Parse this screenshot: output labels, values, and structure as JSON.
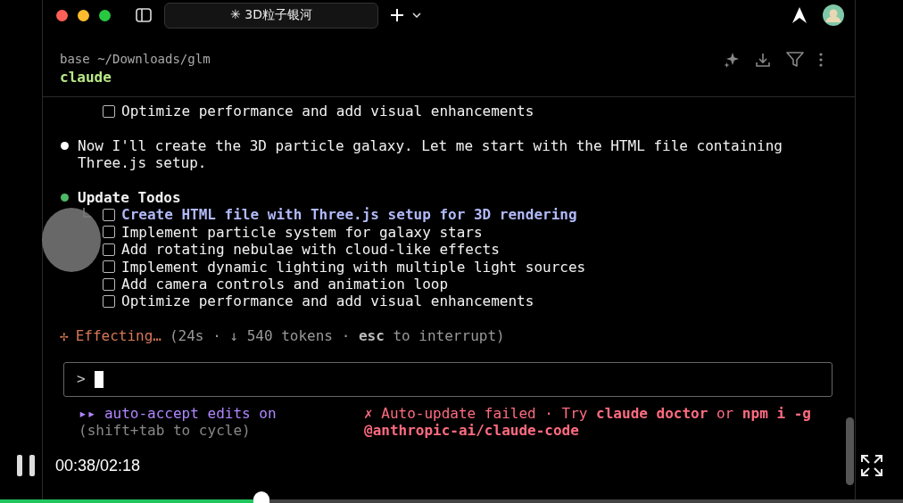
{
  "title_bar": {
    "tab_title": "✳ 3D粒子银河"
  },
  "header": {
    "path": "base ~/Downloads/glm",
    "command": "claude"
  },
  "transcript": [
    {
      "kind": "todo_list",
      "items": [
        {
          "text": "Optimize performance and add visual enhancements",
          "checked": false,
          "active": false
        }
      ]
    },
    {
      "kind": "message",
      "color": "#ffffff",
      "text": "Now I'll create the 3D particle galaxy. Let me start with the HTML file containing Three.js setup."
    },
    {
      "kind": "tool",
      "color": "#4eba65",
      "title": "Update Todos",
      "items": [
        {
          "text": "Create HTML file with Three.js setup for 3D rendering",
          "checked": false,
          "active": true
        },
        {
          "text": "Implement particle system for galaxy stars",
          "checked": false,
          "active": false
        },
        {
          "text": "Add rotating nebulae with cloud-like effects",
          "checked": false,
          "active": false
        },
        {
          "text": "Implement dynamic lighting with multiple light sources",
          "checked": false,
          "active": false
        },
        {
          "text": "Add camera controls and animation loop",
          "checked": false,
          "active": false
        },
        {
          "text": "Optimize performance and add visual enhancements",
          "checked": false,
          "active": false
        }
      ]
    }
  ],
  "status": {
    "spinner": "✢",
    "verb": "Effecting…",
    "detail": "(24s · ↓ 540 tokens · **esc** to interrupt)"
  },
  "input": {
    "prompt": ">"
  },
  "footer": {
    "mode": "▸▸ auto-accept edits on",
    "hint": "(shift+tab to cycle)",
    "warning": "✗ Auto-update failed · Try **claude doctor** or **npm i -g @anthropic-ai/claude-code**"
  },
  "player": {
    "playing": true,
    "time": "00:38/02:18",
    "level": 0.29
  }
}
